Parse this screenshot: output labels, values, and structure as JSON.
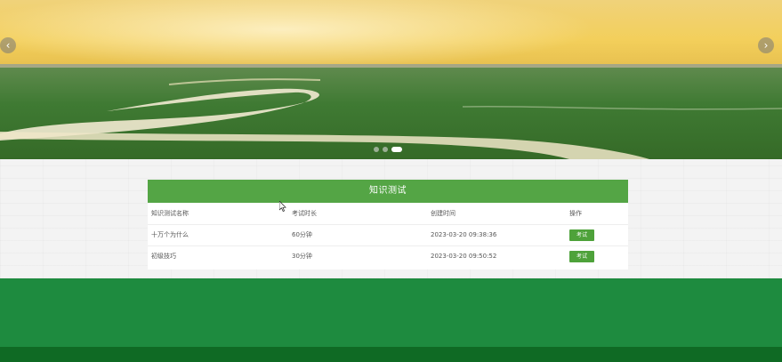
{
  "banner": {
    "prev_icon": "chevron-left",
    "next_icon": "chevron-right",
    "slides": 3,
    "active_slide": 3
  },
  "quiz": {
    "title": "知识测试",
    "columns": [
      "知识测试名称",
      "考试时长",
      "创建时间",
      "操作"
    ],
    "rows": [
      {
        "name": "十万个为什么",
        "duration": "60分钟",
        "created": "2023-03-20 09:38:36",
        "action": "考试"
      },
      {
        "name": "初级技巧",
        "duration": "30分钟",
        "created": "2023-03-20 09:50:52",
        "action": "考试"
      }
    ]
  },
  "colors": {
    "header_green": "#54a545",
    "button_green": "#4ea23a",
    "footer_green": "#1e8b3f",
    "footer_dark": "#0f6a24"
  }
}
